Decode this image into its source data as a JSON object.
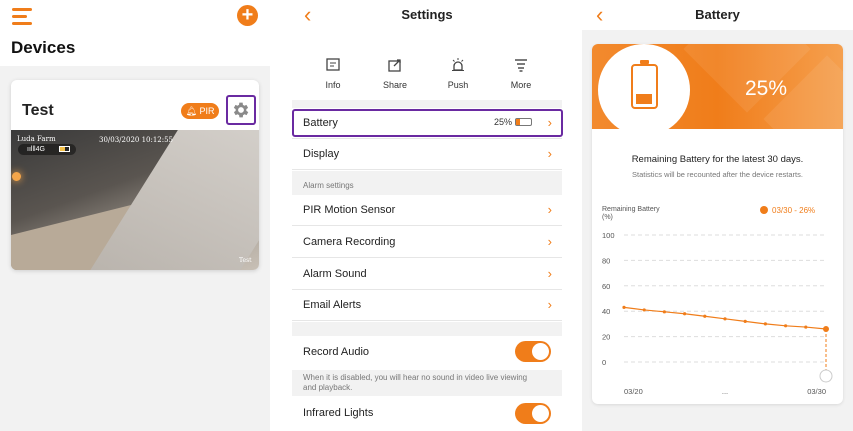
{
  "devices": {
    "title": "Devices",
    "card": {
      "name": "Test",
      "pir_label": "PIR",
      "overlay": {
        "brand": "Luda Farm",
        "timestamp": "30/03/2020 10:12:55",
        "signal": "4G",
        "watermark": "Test"
      }
    }
  },
  "settings": {
    "title": "Settings",
    "actions": [
      {
        "label": "Info",
        "icon": "info-icon"
      },
      {
        "label": "Share",
        "icon": "share-icon"
      },
      {
        "label": "Push",
        "icon": "push-icon"
      },
      {
        "label": "More",
        "icon": "more-icon"
      }
    ],
    "battery": {
      "label": "Battery",
      "value": "25%",
      "level": 0.25
    },
    "display": {
      "label": "Display"
    },
    "alarm_section": "Alarm settings",
    "alarm_items": [
      "PIR Motion Sensor",
      "Camera Recording",
      "Alarm Sound",
      "Email Alerts"
    ],
    "record_audio": {
      "label": "Record Audio",
      "on": true,
      "hint": "When it is disabled, you will hear no sound in video live viewing and playback."
    },
    "infrared": {
      "label": "Infrared Lights",
      "on": true
    }
  },
  "battery_page": {
    "title": "Battery",
    "percent": "25%",
    "remaining_text": "Remaining Battery for the latest 30 days.",
    "recount_text": "Statistics will be recounted after the device restarts.",
    "accent": "#f07d1a"
  },
  "chart_data": {
    "type": "line",
    "ylabel": "Remaining Battery (%)",
    "legend": "03/30 - 26%",
    "yticks": [
      100,
      80,
      60,
      40,
      20,
      0
    ],
    "ylim": [
      0,
      100
    ],
    "xtick_labels": [
      "03/20",
      "...",
      "03/30"
    ],
    "x": [
      0,
      1,
      2,
      3,
      4,
      5,
      6,
      7,
      8,
      9,
      10
    ],
    "values": [
      43,
      41,
      39.5,
      38,
      36,
      34,
      32,
      30,
      28.5,
      27.5,
      26
    ],
    "grid": true
  }
}
